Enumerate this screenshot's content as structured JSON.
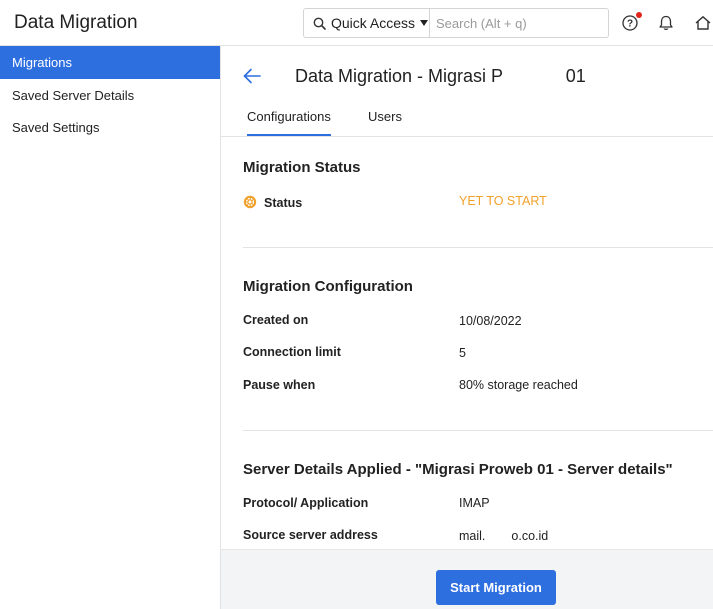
{
  "header": {
    "app_title": "Data Migration",
    "quick_access_label": "Quick Access",
    "search_placeholder": "Search (Alt + q)"
  },
  "sidebar": {
    "items": [
      {
        "label": "Migrations",
        "active": true
      },
      {
        "label": "Saved Server Details",
        "active": false
      },
      {
        "label": "Saved Settings",
        "active": false
      }
    ]
  },
  "main": {
    "title": "Data Migration - Migrasi P",
    "title_suffix": "01",
    "tabs": [
      {
        "label": "Configurations",
        "active": true
      },
      {
        "label": "Users",
        "active": false
      }
    ],
    "migration_status": {
      "heading": "Migration Status",
      "status_label": "Status",
      "status_value": "YET TO START"
    },
    "migration_configuration": {
      "heading": "Migration Configuration",
      "rows": [
        {
          "label": "Created on",
          "value": "10/08/2022"
        },
        {
          "label": "Connection limit",
          "value": "5"
        },
        {
          "label": "Pause when",
          "value": "80% storage reached"
        }
      ]
    },
    "server_details": {
      "heading": "Server Details Applied - \"Migrasi Proweb 01 - Server details\"",
      "rows": [
        {
          "label": "Protocol/ Application",
          "value": "IMAP"
        },
        {
          "label": "Source server address",
          "value": "mail.",
          "value_suffix": "o.co.id"
        }
      ]
    },
    "start_button_label": "Start Migration"
  },
  "colors": {
    "accent": "#2e6fe0",
    "status_pending": "#f0a12b",
    "notification_dot": "#e0241b"
  },
  "icons": [
    "search-icon",
    "chevron-down-icon",
    "help-icon",
    "bell-icon",
    "home-icon",
    "back-arrow-icon",
    "gear-icon"
  ]
}
